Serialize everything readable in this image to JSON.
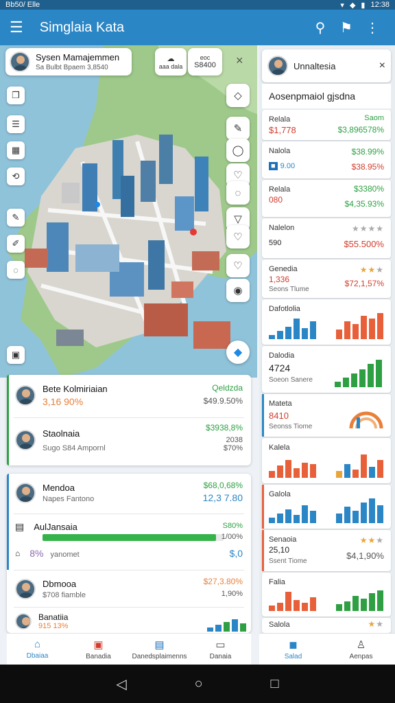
{
  "status": {
    "left": "Bb50/ Elle",
    "time": "12:38",
    "signal": "⚲"
  },
  "appbar": {
    "title": "Simglaia Kata"
  },
  "map": {
    "user_card": {
      "name": "Sysen Mamajemmen",
      "sub": "Sa Bulbt Bpaem  3,8540"
    },
    "chip1": "☁",
    "chip1_sub": "aaa dala",
    "chip2": "S8400",
    "chip2_top": "eoc",
    "close": "×"
  },
  "left_cards": {
    "c1": {
      "name": "Bete Kolmiriaian",
      "value": "3,16 90%",
      "right_top": "Qeldzda",
      "right_val": "$49.9.50%"
    },
    "c2": {
      "name": "Staolnaia",
      "sub": "Sugo S84 Ampornl",
      "right_val": "$3938,8%",
      "right2": "2038",
      "right3": "$70%"
    },
    "c3": {
      "name": "Mendoa",
      "sub": "Napes Fantono",
      "right_val": "$68,0,68%",
      "right2": "12,3 7.80"
    },
    "c4": {
      "name": "AulJansaia",
      "progress_pct": 0.96,
      "right_top": "S80%",
      "right_mid": "1/00%",
      "val": "8%",
      "sub": "yanomet",
      "right_bottom": "$,0"
    },
    "c5": {
      "name": "Dbmooa",
      "sub": "$708 fiamble",
      "right_val": "$27,3.80%",
      "right2": "1,90%"
    },
    "c6": {
      "name": "Banatiia",
      "sub": "915 13%"
    }
  },
  "bottom_nav": [
    {
      "label": "Dbaiaa",
      "icon": "⌂"
    },
    {
      "label": "Banadia",
      "icon": "▣"
    },
    {
      "label": "Danedsplaimenns",
      "icon": "▤"
    },
    {
      "label": "Danaia",
      "icon": "▭"
    }
  ],
  "right_panel": {
    "head_name": "Unnaltesia",
    "close": "×",
    "section_title": "Aosenpmaiol gjsdna",
    "cards": [
      {
        "label": "Relala",
        "value": "$1,778",
        "right_label": "Saom",
        "right_val": "$3,896578%"
      },
      {
        "label": "Nalola",
        "value": "9.00",
        "right_label": "$38.99%",
        "right_val": "$38.95%"
      },
      {
        "label": "Relala",
        "value": "080",
        "right_label": "$3380%",
        "right_val": "$4,35.93%"
      },
      {
        "label": "Nalelon",
        "value": "590",
        "right_val": "$55.500%"
      },
      {
        "label": "Genedia",
        "value": "1,336",
        "sub": "Seons Tlume",
        "right_val": "$72,1,57%"
      },
      {
        "label": "Dafotlolia"
      },
      {
        "label": "Dalodia",
        "value": "4724",
        "sub": "Soeon Sanere"
      },
      {
        "label": "Mateta",
        "value": "8410",
        "sub": "Seonss Tiome"
      },
      {
        "label": "Kalela"
      },
      {
        "label": "Galola"
      },
      {
        "label": "Senaoia",
        "value": "25,10",
        "sub": "Ssent Tiome",
        "right_val": "$4,1,90%"
      },
      {
        "label": "Falia"
      },
      {
        "label": "Salola"
      }
    ],
    "nav": [
      {
        "label": "Salad",
        "icon": "◼"
      },
      {
        "label": "Aenpas",
        "icon": "♙"
      }
    ]
  },
  "colors": {
    "accent": "#2b86c5",
    "green": "#2ea043",
    "red": "#d23c2c",
    "orange": "#e8803a",
    "blue": "#1e88e5"
  }
}
